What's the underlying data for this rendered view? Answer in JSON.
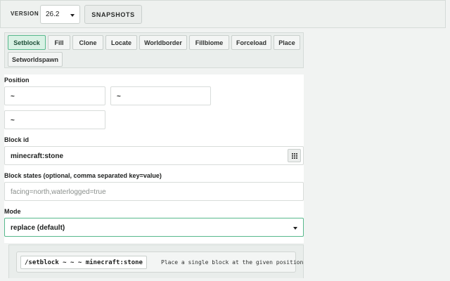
{
  "header": {
    "version_label": "VERSION",
    "version_value": "26.2",
    "snapshots_label": "SNAPSHOTS"
  },
  "tabs": [
    {
      "label": "Setblock",
      "active": true
    },
    {
      "label": "Fill"
    },
    {
      "label": "Clone"
    },
    {
      "label": "Locate"
    },
    {
      "label": "Worldborder"
    },
    {
      "label": "Fillbiome"
    },
    {
      "label": "Forceload"
    },
    {
      "label": "Place"
    },
    {
      "label": "Setworldspawn"
    }
  ],
  "form": {
    "position_label": "Position",
    "position": [
      "~",
      "~",
      "~"
    ],
    "block_id_label": "Block id",
    "block_id_value": "minecraft:stone",
    "block_states_label": "Block states (optional, comma separated key=value)",
    "block_states_placeholder": "facing=north,waterlogged=true",
    "mode_label": "Mode",
    "mode_value": "replace (default)"
  },
  "output": {
    "command": "/setblock ~ ~ ~ minecraft:stone",
    "description": "Place a single block at the given position"
  },
  "colors": {
    "accent": "#58b98c",
    "active_tab_bg": "#d8f1e4"
  }
}
